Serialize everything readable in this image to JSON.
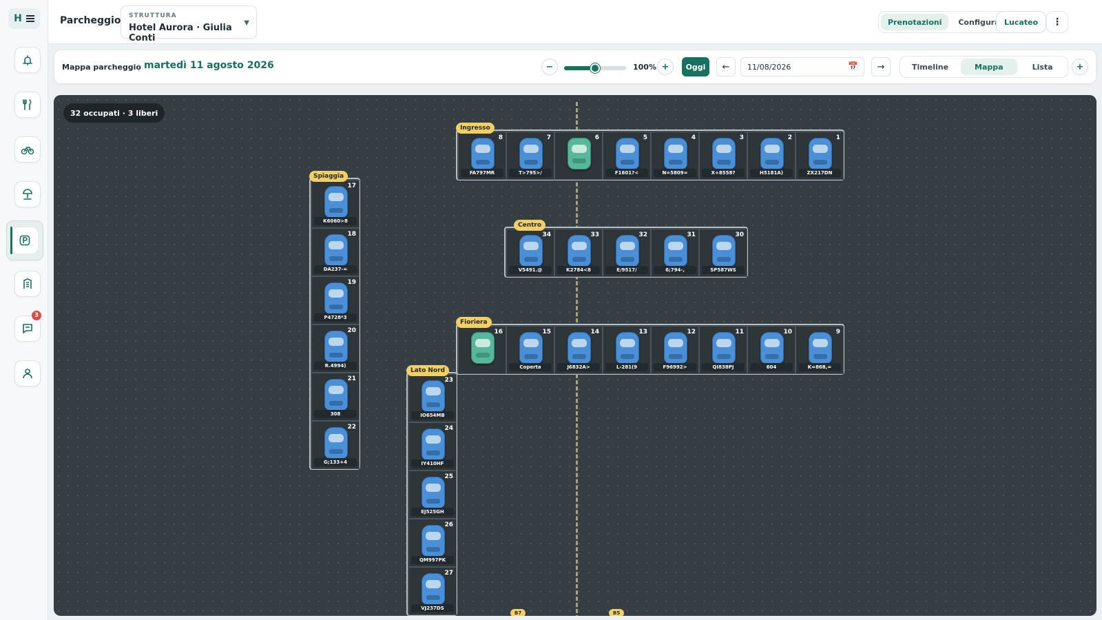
{
  "sidebar": {
    "brand_letter": "H",
    "items": [
      {
        "name": "reception",
        "icon": "bell-icon"
      },
      {
        "name": "restaurant",
        "icon": "utensils-icon"
      },
      {
        "name": "bikes",
        "icon": "bike-icon"
      },
      {
        "name": "beach",
        "icon": "umbrella-icon"
      },
      {
        "name": "parking",
        "icon": "parking-icon",
        "active": true
      },
      {
        "name": "rooms",
        "icon": "building-icon"
      },
      {
        "name": "messages",
        "icon": "chat-icon",
        "badge": "3"
      },
      {
        "name": "account",
        "icon": "user-icon"
      }
    ]
  },
  "header": {
    "title": "Parcheggio",
    "structure_label": "STRUTTURA",
    "structure_value": "Hotel Aurora · Giulia Conti",
    "tabs": [
      {
        "label": "Prenotazioni",
        "selected": true
      },
      {
        "label": "Configurazione",
        "selected": false
      }
    ],
    "user": "Lucateo"
  },
  "toolbar": {
    "title": "Mappa parcheggio",
    "separator": "|",
    "date": "martedì 11 agosto 2026",
    "zoom": "100%",
    "zoom_fraction": 0.5,
    "today": "Oggi",
    "date_input": "11/08/2026",
    "views": [
      {
        "label": "Timeline",
        "selected": false
      },
      {
        "label": "Mappa",
        "selected": true
      },
      {
        "label": "Lista",
        "selected": false
      }
    ]
  },
  "map": {
    "stats": "32 occupati · 3 liberi",
    "sections": [
      {
        "id": "ingresso",
        "label": "Ingresso",
        "spots": [
          {
            "n": "8",
            "plate": "FA797MR",
            "free": false
          },
          {
            "n": "7",
            "plate": "T>795>/",
            "free": false
          },
          {
            "n": "6",
            "plate": "",
            "free": true
          },
          {
            "n": "5",
            "plate": "F1601?<",
            "free": false
          },
          {
            "n": "4",
            "plate": "N=5809=",
            "free": false
          },
          {
            "n": "3",
            "plate": "X+8558?",
            "free": false
          },
          {
            "n": "2",
            "plate": "H5181A)",
            "free": false
          },
          {
            "n": "1",
            "plate": "ZX217DN",
            "free": false
          }
        ]
      },
      {
        "id": "centro",
        "label": "Centro",
        "spots": [
          {
            "n": "34",
            "plate": "V5491.@",
            "free": false
          },
          {
            "n": "33",
            "plate": "K2784<8",
            "free": false
          },
          {
            "n": "32",
            "plate": "E/9517/",
            "free": false
          },
          {
            "n": "31",
            "plate": "6;794-,",
            "free": false
          },
          {
            "n": "30",
            "plate": "SP587WS",
            "free": false
          }
        ]
      },
      {
        "id": "fioriera",
        "label": "Fioriera",
        "spots": [
          {
            "n": "16",
            "plate": "",
            "free": true
          },
          {
            "n": "15",
            "plate": "Coperta",
            "free": false
          },
          {
            "n": "14",
            "plate": "J6832A>",
            "free": false
          },
          {
            "n": "13",
            "plate": "L-281(9",
            "free": false
          },
          {
            "n": "12",
            "plate": "F96992>",
            "free": false
          },
          {
            "n": "11",
            "plate": "QI838PJ",
            "free": false
          },
          {
            "n": "10",
            "plate": "604",
            "free": false
          },
          {
            "n": "9",
            "plate": "K=868,=",
            "free": false
          }
        ]
      },
      {
        "id": "spiaggia",
        "label": "Spiaggia",
        "spots": [
          {
            "n": "17",
            "plate": "K6060>8",
            "free": false
          },
          {
            "n": "18",
            "plate": "DA237-=",
            "free": false
          },
          {
            "n": "19",
            "plate": "P4728*3",
            "free": false
          },
          {
            "n": "20",
            "plate": "R.4994)",
            "free": false
          },
          {
            "n": "21",
            "plate": "308",
            "free": false
          },
          {
            "n": "22",
            "plate": "G;133+4",
            "free": false
          }
        ]
      },
      {
        "id": "latonord",
        "label": "Lato Nord",
        "spots": [
          {
            "n": "23",
            "plate": "IO654MB",
            "free": false
          },
          {
            "n": "24",
            "plate": "IY410HF",
            "free": false
          },
          {
            "n": "25",
            "plate": "EJ525GH",
            "free": false
          },
          {
            "n": "26",
            "plate": "QM997PK",
            "free": false
          },
          {
            "n": "27",
            "plate": "VJ237DS",
            "free": false
          }
        ]
      }
    ],
    "cut_tags": [
      "B7",
      "B5"
    ]
  }
}
